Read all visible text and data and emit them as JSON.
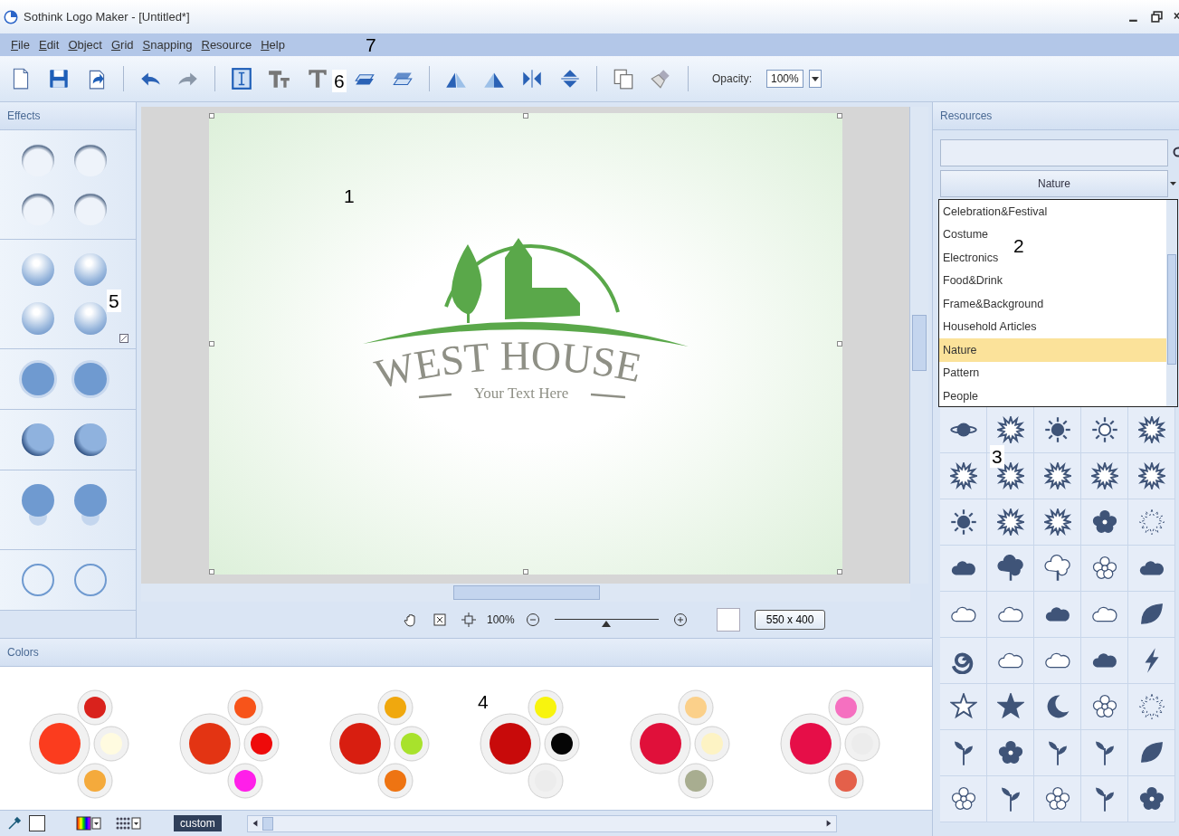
{
  "window": {
    "title": "Sothink Logo Maker - [Untitled*]"
  },
  "menu": [
    {
      "label": "File"
    },
    {
      "label": "Edit"
    },
    {
      "label": "Object"
    },
    {
      "label": "Grid"
    },
    {
      "label": "Snapping"
    },
    {
      "label": "Resource"
    },
    {
      "label": "Help"
    }
  ],
  "toolbar": {
    "opacity_label": "Opacity:",
    "opacity_value": "100%"
  },
  "effects_panel": {
    "title": "Effects"
  },
  "canvas": {
    "logo_title": "WEST HOUSE",
    "logo_subtitle": "Your Text Here"
  },
  "canvas_controls": {
    "zoom": "100%",
    "zoom_slider": {
      "level": 0.5
    },
    "size": "550 x 400"
  },
  "colors_panel": {
    "title": "Colors",
    "palettes": [
      {
        "colors": [
          {
            "color": "#fb3c1e"
          },
          {
            "color": "#d9221c"
          },
          {
            "color": "#fffbe0"
          },
          {
            "color": "#f4aa3c"
          }
        ]
      },
      {
        "colors": [
          {
            "color": "#e33413"
          },
          {
            "color": "#f7541a"
          },
          {
            "color": "#ee0a0a"
          },
          {
            "color": "#ff1fe9"
          }
        ]
      },
      {
        "colors": [
          {
            "color": "#d81e10"
          },
          {
            "color": "#f0a80e"
          },
          {
            "color": "#a8e22c"
          },
          {
            "color": "#ee7412"
          }
        ]
      },
      {
        "colors": [
          {
            "color": "#c80a0a"
          },
          {
            "color": "#f8f40e"
          },
          {
            "color": "#050505"
          },
          {
            "color": "#ececec"
          }
        ]
      },
      {
        "colors": [
          {
            "color": "#e0103a"
          },
          {
            "color": "#fbd08a"
          },
          {
            "color": "#fdf3c4"
          },
          {
            "color": "#a8ad90"
          }
        ]
      },
      {
        "colors": [
          {
            "color": "#e60e48"
          },
          {
            "color": "#f570c0"
          },
          {
            "color": "#ececec"
          },
          {
            "color": "#e4604a"
          }
        ]
      }
    ],
    "custom_label": "custom"
  },
  "resources_panel": {
    "title": "Resources",
    "category": "Nature",
    "categories": [
      {
        "label": "Celebration&Festival",
        "selected": false
      },
      {
        "label": "Costume",
        "selected": false
      },
      {
        "label": "Electronics",
        "selected": false
      },
      {
        "label": "Food&Drink",
        "selected": false
      },
      {
        "label": "Frame&Background",
        "selected": false
      },
      {
        "label": "Household Articles",
        "selected": false
      },
      {
        "label": "Nature",
        "selected": true
      },
      {
        "label": "Pattern",
        "selected": false
      },
      {
        "label": "People",
        "selected": false
      }
    ]
  },
  "callouts": [
    {
      "label": "1"
    },
    {
      "label": "2"
    },
    {
      "label": "3"
    },
    {
      "label": "4"
    },
    {
      "label": "5"
    },
    {
      "label": "6"
    },
    {
      "label": "7"
    }
  ]
}
